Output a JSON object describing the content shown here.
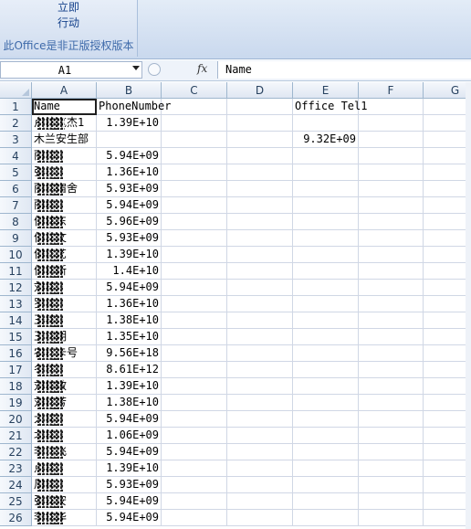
{
  "ribbon": {
    "button_label_line1": "立即",
    "button_label_line2": "行动",
    "caption": "此Office是非正版授权版本"
  },
  "formula_bar": {
    "name_box": "A1",
    "fx_label": "fx",
    "formula": "Name"
  },
  "columns": [
    "A",
    "B",
    "C",
    "D",
    "E",
    "F",
    "G"
  ],
  "rows": [
    {
      "n": "1",
      "a": "Name",
      "b": "PhoneNumber",
      "e": "Office Tel1"
    },
    {
      "n": "2",
      "a": "卢德克杰1",
      "b": "1.39E+10",
      "e": ""
    },
    {
      "n": "3",
      "a": "木兰安生部",
      "b": "",
      "e": "9.32E+09"
    },
    {
      "n": "4",
      "a": "丽丽",
      "b": "5.94E+09",
      "e": ""
    },
    {
      "n": "5",
      "a": "张小",
      "b": "1.36E+10",
      "e": ""
    },
    {
      "n": "6",
      "a": "丽丽宿舍",
      "b": "5.93E+09",
      "e": ""
    },
    {
      "n": "7",
      "a": "丽丽",
      "b": "5.94E+09",
      "e": ""
    },
    {
      "n": "8",
      "a": "何建东",
      "b": "5.96E+09",
      "e": ""
    },
    {
      "n": "9",
      "a": "何文文",
      "b": "5.93E+09",
      "e": ""
    },
    {
      "n": "10",
      "a": "何艺艺",
      "b": "1.39E+10",
      "e": ""
    },
    {
      "n": "11",
      "a": "何新新",
      "b": "1.4E+10",
      "e": ""
    },
    {
      "n": "12",
      "a": "刘某",
      "b": "5.94E+09",
      "e": ""
    },
    {
      "n": "13",
      "a": "罗某",
      "b": "1.36E+10",
      "e": ""
    },
    {
      "n": "14",
      "a": "王某",
      "b": "1.38E+10",
      "e": ""
    },
    {
      "n": "15",
      "a": "王明明",
      "b": "1.35E+10",
      "e": ""
    },
    {
      "n": "16",
      "a": "农行卡号",
      "b": "9.56E+18",
      "e": ""
    },
    {
      "n": "17",
      "a": "冬冬",
      "b": "8.61E+12",
      "e": ""
    },
    {
      "n": "18",
      "a": "刘俊敏",
      "b": "1.39E+10",
      "e": ""
    },
    {
      "n": "19",
      "a": "刘芳芳",
      "b": "1.38E+10",
      "e": ""
    },
    {
      "n": "20",
      "a": "大某",
      "b": "5.94E+09",
      "e": ""
    },
    {
      "n": "21",
      "a": "北某",
      "b": "1.06E+09",
      "e": ""
    },
    {
      "n": "22",
      "a": "李飞飞",
      "b": "5.94E+09",
      "e": ""
    },
    {
      "n": "23",
      "a": "点某",
      "b": "1.39E+10",
      "e": ""
    },
    {
      "n": "24",
      "a": "周某",
      "b": "5.93E+09",
      "e": ""
    },
    {
      "n": "25",
      "a": "张安安",
      "b": "5.94E+09",
      "e": ""
    },
    {
      "n": "26",
      "a": "李华华",
      "b": "5.94E+09",
      "e": ""
    }
  ]
}
